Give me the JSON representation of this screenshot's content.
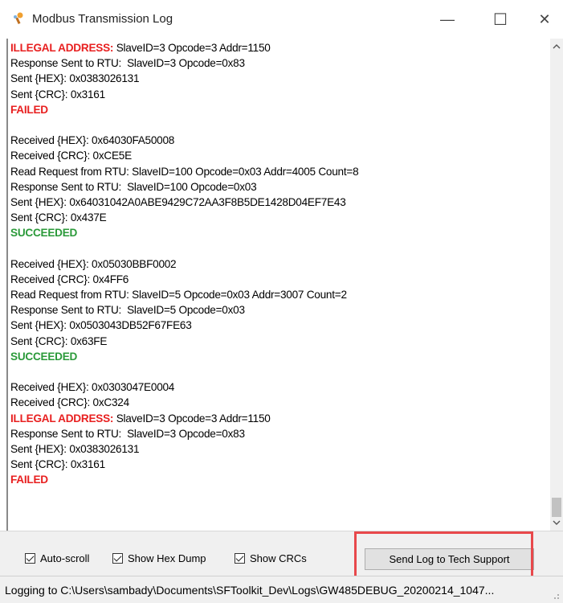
{
  "window": {
    "title": "Modbus Transmission Log",
    "minimize_glyph": "—",
    "maximize_glyph": "☐",
    "close_glyph": "✕"
  },
  "log": {
    "lines": [
      {
        "style": "red-prefix",
        "prefix": "ILLEGAL ADDRESS:",
        "text": " SlaveID=3 Opcode=3 Addr=1150"
      },
      {
        "style": "normal",
        "text": "Response Sent to RTU:  SlaveID=3 Opcode=0x83"
      },
      {
        "style": "normal",
        "text": "Sent {HEX}: 0x0383026131"
      },
      {
        "style": "normal",
        "text": "Sent {CRC}: 0x3161"
      },
      {
        "style": "red",
        "text": "FAILED"
      },
      {
        "style": "normal",
        "text": ""
      },
      {
        "style": "normal",
        "text": "Received {HEX}: 0x64030FA50008"
      },
      {
        "style": "normal",
        "text": "Received {CRC}: 0xCE5E"
      },
      {
        "style": "normal",
        "text": "Read Request from RTU: SlaveID=100 Opcode=0x03 Addr=4005 Count=8"
      },
      {
        "style": "normal",
        "text": "Response Sent to RTU:  SlaveID=100 Opcode=0x03"
      },
      {
        "style": "normal",
        "text": "Sent {HEX}: 0x64031042A0ABE9429C72AA3F8B5DE1428D04EF7E43"
      },
      {
        "style": "normal",
        "text": "Sent {CRC}: 0x437E"
      },
      {
        "style": "green",
        "text": "SUCCEEDED"
      },
      {
        "style": "normal",
        "text": ""
      },
      {
        "style": "normal",
        "text": "Received {HEX}: 0x05030BBF0002"
      },
      {
        "style": "normal",
        "text": "Received {CRC}: 0x4FF6"
      },
      {
        "style": "normal",
        "text": "Read Request from RTU: SlaveID=5 Opcode=0x03 Addr=3007 Count=2"
      },
      {
        "style": "normal",
        "text": "Response Sent to RTU:  SlaveID=5 Opcode=0x03"
      },
      {
        "style": "normal",
        "text": "Sent {HEX}: 0x0503043DB52F67FE63"
      },
      {
        "style": "normal",
        "text": "Sent {CRC}: 0x63FE"
      },
      {
        "style": "green",
        "text": "SUCCEEDED"
      },
      {
        "style": "normal",
        "text": ""
      },
      {
        "style": "normal",
        "text": "Received {HEX}: 0x0303047E0004"
      },
      {
        "style": "normal",
        "text": "Received {CRC}: 0xC324"
      },
      {
        "style": "red-prefix",
        "prefix": "ILLEGAL ADDRESS:",
        "text": " SlaveID=3 Opcode=3 Addr=1150"
      },
      {
        "style": "normal",
        "text": "Response Sent to RTU:  SlaveID=3 Opcode=0x83"
      },
      {
        "style": "normal",
        "text": "Sent {HEX}: 0x0383026131"
      },
      {
        "style": "normal",
        "text": "Sent {CRC}: 0x3161"
      },
      {
        "style": "red",
        "text": "FAILED"
      }
    ]
  },
  "controls": {
    "auto_scroll": {
      "label": "Auto-scroll",
      "checked": true
    },
    "show_hex_dump": {
      "label": "Show Hex Dump",
      "checked": true
    },
    "show_crcs": {
      "label": "Show CRCs",
      "checked": true
    },
    "send_button": "Send Log to Tech Support"
  },
  "status": {
    "text": "Logging to C:\\Users\\sambady\\Documents\\SFToolkit_Dev\\Logs\\GW485DEBUG_20200214_1047..."
  },
  "colors": {
    "error": "#e82020",
    "success": "#2b9a3a",
    "highlight": "#e8484b"
  },
  "icons": {
    "app": "modbus-app-icon",
    "scroll_up": "chevron-up-icon",
    "scroll_down": "chevron-down-icon",
    "check": "checkmark-icon"
  }
}
